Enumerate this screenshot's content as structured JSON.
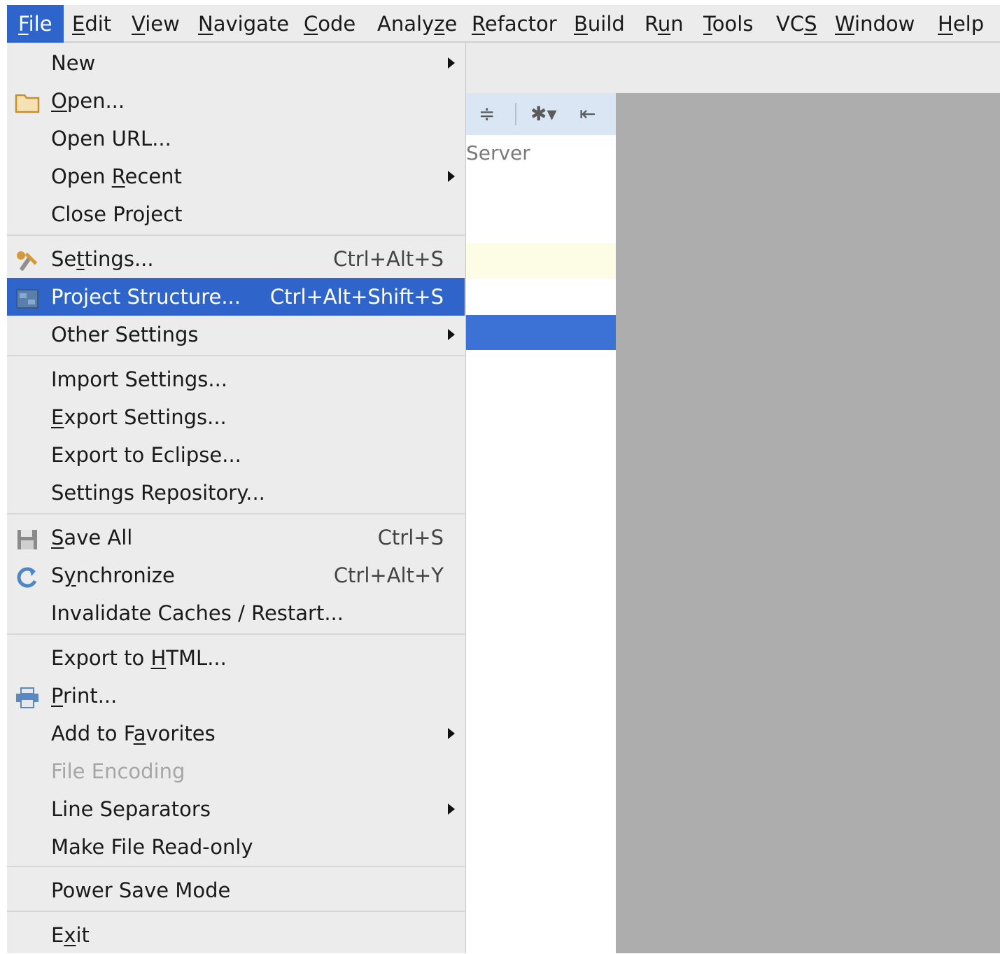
{
  "menubar": {
    "items": [
      {
        "label": "File",
        "mnemonic": "F"
      },
      {
        "label": "Edit",
        "mnemonic": "E"
      },
      {
        "label": "View",
        "mnemonic": "V"
      },
      {
        "label": "Navigate",
        "mnemonic": "N"
      },
      {
        "label": "Code",
        "mnemonic": "C"
      },
      {
        "label": "Analyze",
        "mnemonic": "z"
      },
      {
        "label": "Refactor",
        "mnemonic": "R"
      },
      {
        "label": "Build",
        "mnemonic": "B"
      },
      {
        "label": "Run",
        "mnemonic": "u"
      },
      {
        "label": "Tools",
        "mnemonic": "T"
      },
      {
        "label": "VCS",
        "mnemonic": "S"
      },
      {
        "label": "Window",
        "mnemonic": "W"
      },
      {
        "label": "Help",
        "mnemonic": "H"
      }
    ]
  },
  "file_menu": {
    "items": [
      {
        "label": "New",
        "mnemonic": "",
        "shortcut": "",
        "submenu": true,
        "icon": ""
      },
      {
        "label": "Open...",
        "mnemonic": "O",
        "shortcut": "",
        "submenu": false,
        "icon": "folder-icon"
      },
      {
        "label": "Open URL...",
        "mnemonic": "",
        "shortcut": "",
        "submenu": false,
        "icon": ""
      },
      {
        "label": "Open Recent",
        "mnemonic": "R",
        "shortcut": "",
        "submenu": true,
        "icon": ""
      },
      {
        "label": "Close Project",
        "mnemonic": "",
        "shortcut": "",
        "submenu": false,
        "icon": ""
      },
      {
        "label": "Settings...",
        "mnemonic": "t",
        "shortcut": "Ctrl+Alt+S",
        "submenu": false,
        "icon": "wrench-icon"
      },
      {
        "label": "Project Structure...",
        "mnemonic": "",
        "shortcut": "Ctrl+Alt+Shift+S",
        "submenu": false,
        "icon": "project-structure-icon",
        "selected": true
      },
      {
        "label": "Other Settings",
        "mnemonic": "",
        "shortcut": "",
        "submenu": true,
        "icon": ""
      },
      {
        "label": "Import Settings...",
        "mnemonic": "",
        "shortcut": "",
        "submenu": false,
        "icon": ""
      },
      {
        "label": "Export Settings...",
        "mnemonic": "E",
        "shortcut": "",
        "submenu": false,
        "icon": ""
      },
      {
        "label": "Export to Eclipse...",
        "mnemonic": "",
        "shortcut": "",
        "submenu": false,
        "icon": ""
      },
      {
        "label": "Settings Repository...",
        "mnemonic": "",
        "shortcut": "",
        "submenu": false,
        "icon": ""
      },
      {
        "label": "Save All",
        "mnemonic": "S",
        "shortcut": "Ctrl+S",
        "submenu": false,
        "icon": "save-icon"
      },
      {
        "label": "Synchronize",
        "mnemonic": "y",
        "shortcut": "Ctrl+Alt+Y",
        "submenu": false,
        "icon": "sync-icon"
      },
      {
        "label": "Invalidate Caches / Restart...",
        "mnemonic": "",
        "shortcut": "",
        "submenu": false,
        "icon": ""
      },
      {
        "label": "Export to HTML...",
        "mnemonic": "H",
        "shortcut": "",
        "submenu": false,
        "icon": ""
      },
      {
        "label": "Print...",
        "mnemonic": "P",
        "shortcut": "",
        "submenu": false,
        "icon": "print-icon"
      },
      {
        "label": "Add to Favorites",
        "mnemonic": "a",
        "shortcut": "",
        "submenu": true,
        "icon": ""
      },
      {
        "label": "File Encoding",
        "mnemonic": "",
        "shortcut": "",
        "submenu": false,
        "icon": "",
        "disabled": true
      },
      {
        "label": "Line Separators",
        "mnemonic": "",
        "shortcut": "",
        "submenu": true,
        "icon": ""
      },
      {
        "label": "Make File Read-only",
        "mnemonic": "",
        "shortcut": "",
        "submenu": false,
        "icon": ""
      },
      {
        "label": "Power Save Mode",
        "mnemonic": "",
        "shortcut": "",
        "submenu": false,
        "icon": ""
      },
      {
        "label": "Exit",
        "mnemonic": "x",
        "shortcut": "",
        "submenu": false,
        "icon": ""
      }
    ]
  },
  "project_panel": {
    "tree_item": "tServer"
  },
  "colors": {
    "selection": "#2f65ca",
    "menu_bg": "#ececec",
    "disabled_text": "#a6a6a6",
    "editor_empty_bg": "#adadad"
  }
}
